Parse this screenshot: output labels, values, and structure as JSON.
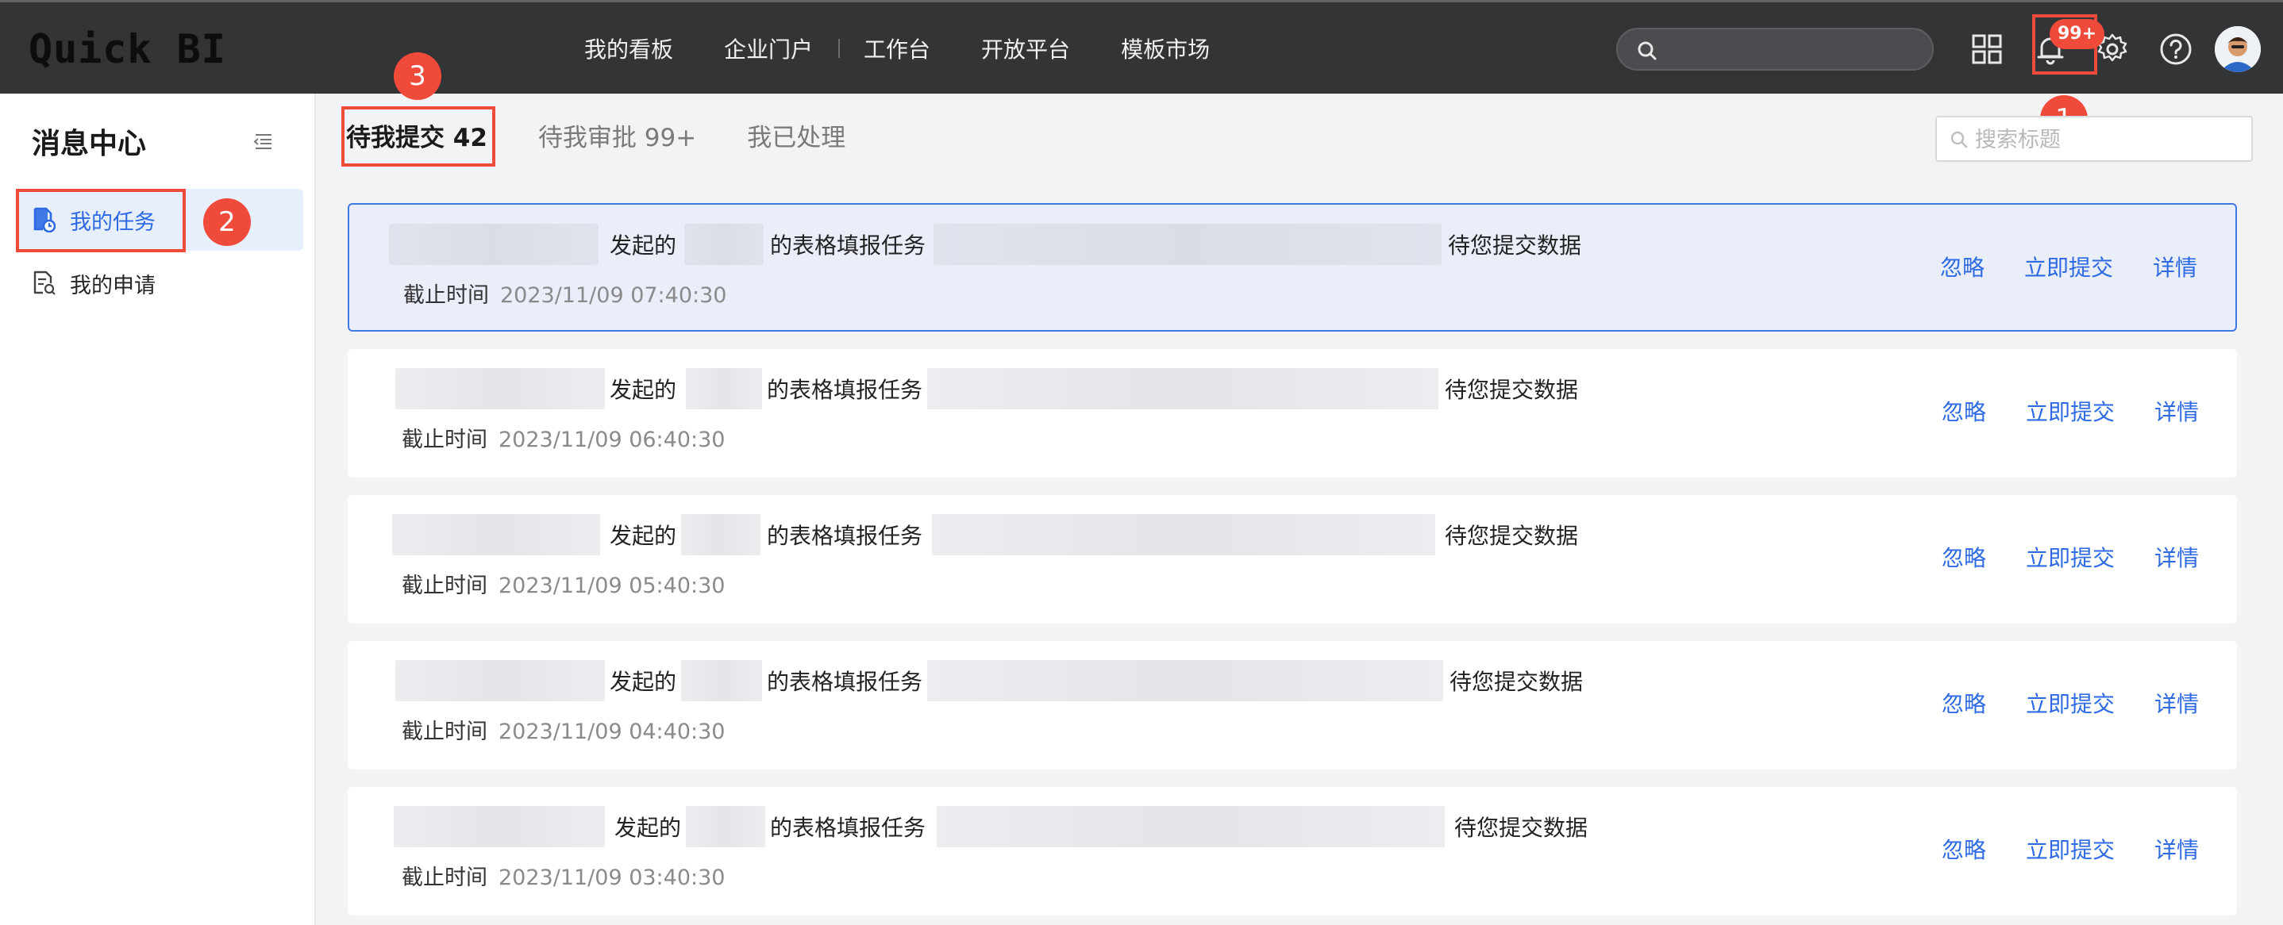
{
  "header": {
    "logo": "Quick BI",
    "nav": [
      "我的看板",
      "企业门户",
      "工作台",
      "开放平台",
      "模板市场"
    ],
    "notification_badge": "99+"
  },
  "sidebar": {
    "title": "消息中心",
    "items": [
      {
        "label": "我的任务",
        "active": true
      },
      {
        "label": "我的申请",
        "active": false
      }
    ]
  },
  "tabs": [
    {
      "label": "待我提交 42",
      "active": true
    },
    {
      "label": "待我审批 99+",
      "active": false
    },
    {
      "label": "我已处理",
      "active": false
    }
  ],
  "search": {
    "placeholder": "搜索标题"
  },
  "task_text": {
    "initiated": "发起的",
    "form_task": "的表格填报任务",
    "awaiting": "待您提交数据",
    "deadline_label": "截止时间"
  },
  "tasks": [
    {
      "deadline": "2023/11/09 07:40:30"
    },
    {
      "deadline": "2023/11/09 06:40:30"
    },
    {
      "deadline": "2023/11/09 05:40:30"
    },
    {
      "deadline": "2023/11/09 04:40:30"
    },
    {
      "deadline": "2023/11/09 03:40:30"
    }
  ],
  "actions": {
    "ignore": "忽略",
    "submit": "立即提交",
    "detail": "详情"
  },
  "annotations": [
    "1",
    "2",
    "3"
  ],
  "colors": {
    "accent": "#2d6ae3",
    "annotation": "#f04a3a",
    "topbar": "#323436"
  }
}
